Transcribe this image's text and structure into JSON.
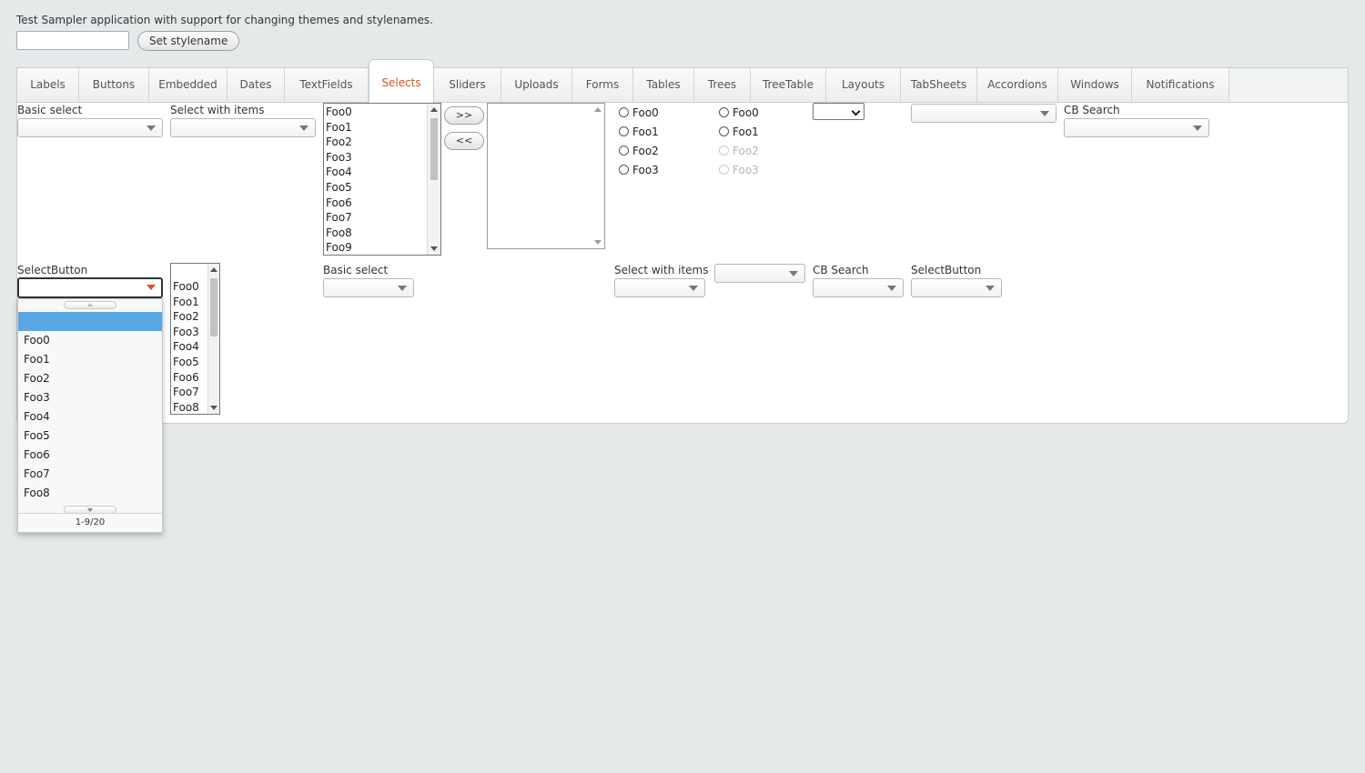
{
  "intro_text": "Test Sampler application with support for changing themes and stylenames.",
  "stylename": {
    "value": "",
    "button_label": "Set stylename"
  },
  "tabs": [
    "Labels",
    "Buttons",
    "Embedded",
    "Dates",
    "TextFields",
    "Selects",
    "Sliders",
    "Uploads",
    "Forms",
    "Tables",
    "Trees",
    "TreeTable",
    "Layouts",
    "TabSheets",
    "Accordions",
    "Windows",
    "Notifications"
  ],
  "selected_tab": "Selects",
  "accent_color": "#d2581b",
  "highlight_color": "#5aa7e6",
  "row1": {
    "basic_select_caption": "Basic select",
    "select_with_items_caption": "Select with items",
    "list_select_items": [
      "Foo0",
      "Foo1",
      "Foo2",
      "Foo3",
      "Foo4",
      "Foo5",
      "Foo6",
      "Foo7",
      "Foo8",
      "Foo9"
    ],
    "twin_add_label": ">>",
    "twin_remove_label": "<<",
    "option_group_1": [
      "Foo0",
      "Foo1",
      "Foo2",
      "Foo3"
    ],
    "option_group_2": {
      "enabled": [
        "Foo0",
        "Foo1"
      ],
      "disabled": [
        "Foo2",
        "Foo3"
      ]
    },
    "cb_search_caption": "CB Search"
  },
  "row2": {
    "select_button_caption": "SelectButton",
    "small_list_items": [
      "Foo0",
      "Foo1",
      "Foo2",
      "Foo3",
      "Foo4",
      "Foo5",
      "Foo6",
      "Foo7",
      "Foo8"
    ],
    "basic_select_caption": "Basic select",
    "select_with_items_caption": "Select with items",
    "cb_search_caption": "CB Search",
    "select_button_caption_2": "SelectButton"
  },
  "popup": {
    "items": [
      "Foo0",
      "Foo1",
      "Foo2",
      "Foo3",
      "Foo4",
      "Foo5",
      "Foo6",
      "Foo7",
      "Foo8"
    ],
    "status": "1-9/20"
  }
}
